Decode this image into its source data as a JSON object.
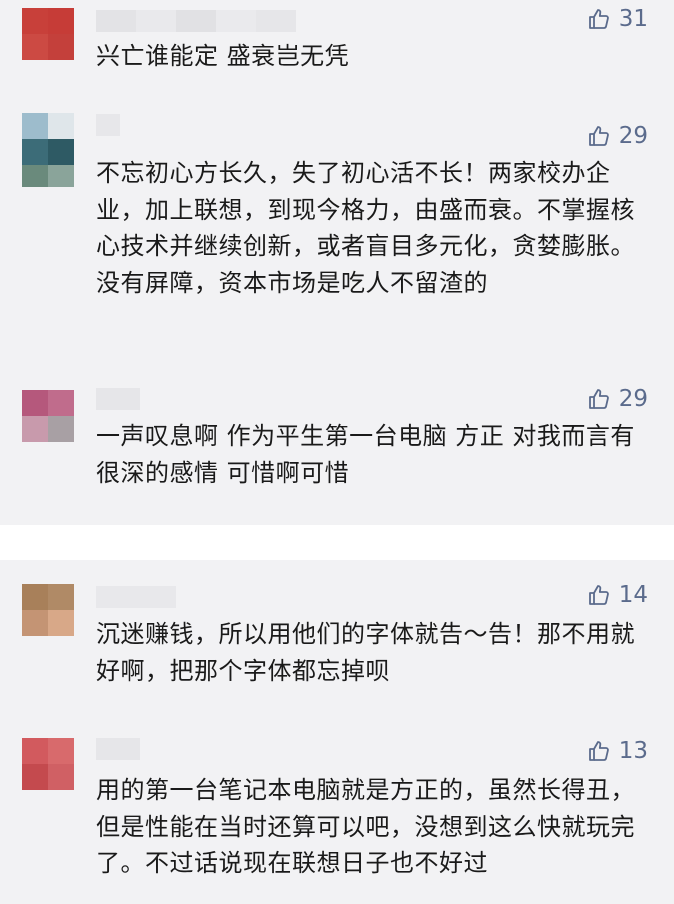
{
  "colors": {
    "card_bg": "#f2f2f4",
    "text": "#1a1a1a",
    "like": "#5b6b8c"
  },
  "icon": "thumbs-up-icon",
  "comments": [
    {
      "likes": "31",
      "text": "兴亡谁能定 盛衰岂无凭"
    },
    {
      "likes": "29",
      "text": "不忘初心方长久，失了初心活不长！两家校办企业，加上联想，到现今格力，由盛而衰。不掌握核心技术并继续创新，或者盲目多元化，贪婪膨胀。没有屏障，资本市场是吃人不留渣的"
    },
    {
      "likes": "29",
      "text": "一声叹息啊 作为平生第一台电脑 方正 对我而言有很深的感情 可惜啊可惜"
    },
    {
      "likes": "14",
      "text": "沉迷赚钱，所以用他们的字体就告～告！那不用就好啊，把那个字体都忘掉呗"
    },
    {
      "likes": "13",
      "text": "用的第一台笔记本电脑就是方正的，虽然长得丑，但是性能在当时还算可以吧，没想到这么快就玩完了。不过话说现在联想日子也不好过"
    }
  ]
}
